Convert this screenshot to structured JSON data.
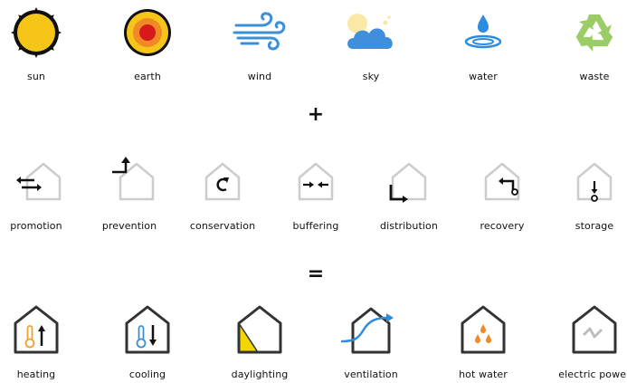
{
  "sources": [
    {
      "icon": "sun-icon",
      "label": "sun"
    },
    {
      "icon": "earth-icon",
      "label": "earth"
    },
    {
      "icon": "wind-icon",
      "label": "wind"
    },
    {
      "icon": "sky-icon",
      "label": "sky"
    },
    {
      "icon": "water-icon",
      "label": "water"
    },
    {
      "icon": "recycle-icon",
      "label": "waste"
    }
  ],
  "plus_symbol": "+",
  "strategies": [
    {
      "icon": "promotion-icon",
      "label": "promotion"
    },
    {
      "icon": "prevention-icon",
      "label": "prevention"
    },
    {
      "icon": "conservation-icon",
      "label": "conservation"
    },
    {
      "icon": "buffering-icon",
      "label": "buffering"
    },
    {
      "icon": "distribution-icon",
      "label": "distribution"
    },
    {
      "icon": "recovery-icon",
      "label": "recovery"
    },
    {
      "icon": "storage-icon",
      "label": "storage"
    }
  ],
  "equals_symbol": "=",
  "services": [
    {
      "icon": "heating-icon",
      "label": "heating"
    },
    {
      "icon": "cooling-icon",
      "label": "cooling"
    },
    {
      "icon": "daylighting-icon",
      "label": "daylighting"
    },
    {
      "icon": "ventilation-icon",
      "label": "ventilation"
    },
    {
      "icon": "hot-water-icon",
      "label": "hot water"
    },
    {
      "icon": "electric-power-icon",
      "label": "electric power"
    }
  ],
  "colors": {
    "sun_yellow": "#f5c518",
    "earth_red": "#d7191c",
    "earth_orange": "#f08a24",
    "wind_blue": "#3d8fd6",
    "sky_blue": "#3f8fdc",
    "water_blue": "#2b8ce0",
    "recycle_green": "#9ccc65",
    "house_grey": "#cccccc",
    "house_dark": "#333333",
    "heat_orange": "#f0a030",
    "daylight_yellow": "#f2d600"
  }
}
